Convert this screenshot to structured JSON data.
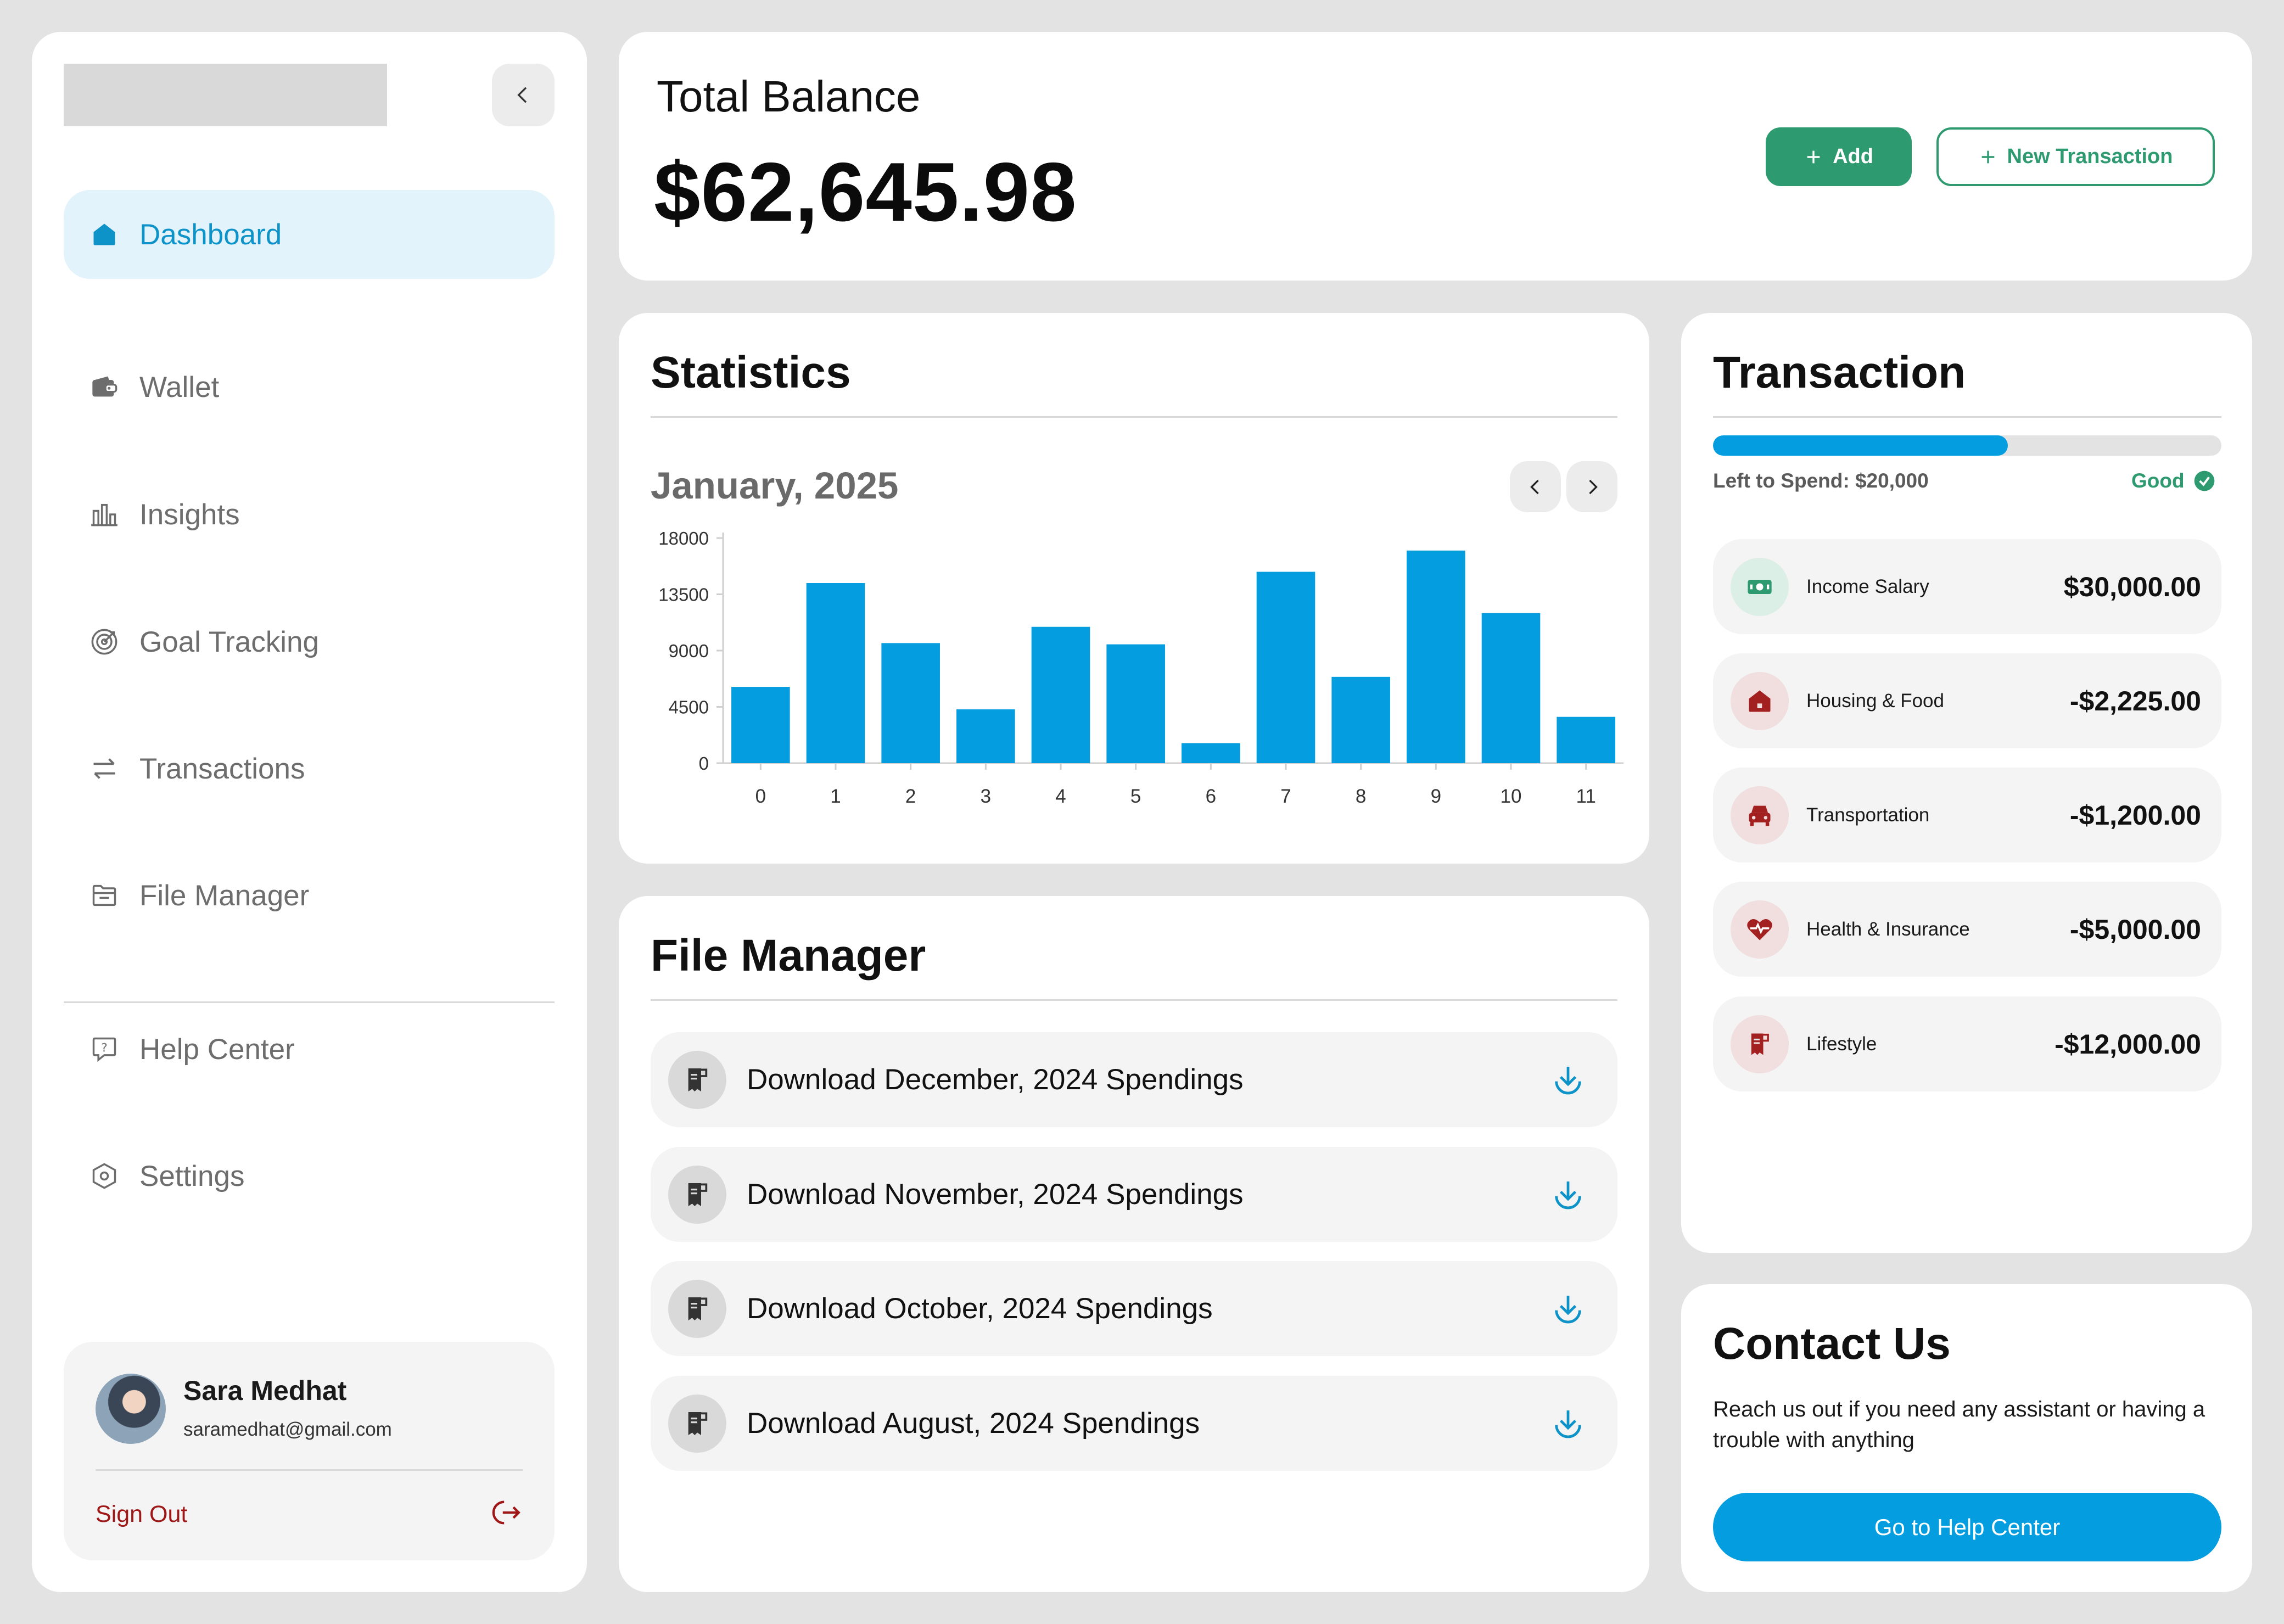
{
  "sidebar": {
    "nav": [
      {
        "label": "Dashboard",
        "icon": "home-icon",
        "active": true
      },
      {
        "label": "Wallet",
        "icon": "wallet-icon"
      },
      {
        "label": "Insights",
        "icon": "bar-chart-icon"
      },
      {
        "label": "Goal Tracking",
        "icon": "target-icon"
      },
      {
        "label": "Transactions",
        "icon": "swap-arrows-icon"
      },
      {
        "label": "File Manager",
        "icon": "folder-icon"
      }
    ],
    "support": [
      {
        "label": "Help Center",
        "icon": "help-chat-icon"
      },
      {
        "label": "Settings",
        "icon": "settings-hex-icon"
      }
    ],
    "profile": {
      "name": "Sara Medhat",
      "email": "saramedhat@gmail.com",
      "sign_out": "Sign Out"
    }
  },
  "balance": {
    "label": "Total Balance",
    "value": "$62,645.98",
    "add_label": "Add",
    "new_transaction_label": "New Transaction"
  },
  "statistics": {
    "title": "Statistics",
    "month": "January, 2025"
  },
  "chart_data": {
    "type": "bar",
    "categories": [
      "0",
      "1",
      "2",
      "3",
      "4",
      "5",
      "6",
      "7",
      "8",
      "9",
      "10",
      "11"
    ],
    "values": [
      6100,
      14400,
      9600,
      4300,
      10900,
      9500,
      1600,
      15300,
      6900,
      17000,
      12000,
      3700
    ],
    "y_ticks": [
      "0",
      "4500",
      "9000",
      "13500",
      "18000"
    ],
    "ylim": [
      0,
      18000
    ],
    "color": "#049ee0",
    "grid": false
  },
  "file_manager": {
    "title": "File Manager",
    "files": [
      {
        "label": "Download December, 2024 Spendings"
      },
      {
        "label": "Download November, 2024 Spendings"
      },
      {
        "label": "Download October, 2024 Spendings"
      },
      {
        "label": "Download August, 2024 Spendings"
      }
    ]
  },
  "transaction": {
    "title": "Transaction",
    "progress": 0.58,
    "left_to_spend": "Left to Spend: $20,000",
    "status": "Good",
    "items": [
      {
        "label": "Income Salary",
        "amount": "$30,000.00",
        "icon": "money-icon",
        "color": "#2e9a6f"
      },
      {
        "label": "Housing & Food",
        "amount": "-$2,225.00",
        "icon": "house-icon",
        "color": "#a32020"
      },
      {
        "label": "Transportation",
        "amount": "-$1,200.00",
        "icon": "car-icon",
        "color": "#a32020"
      },
      {
        "label": "Health & Insurance",
        "amount": "-$5,000.00",
        "icon": "heart-pulse-icon",
        "color": "#a32020"
      },
      {
        "label": "Lifestyle",
        "amount": "-$12,000.00",
        "icon": "receipt-icon",
        "color": "#a32020"
      }
    ]
  },
  "contact": {
    "title": "Contact Us",
    "text": "Reach us out if you need any assistant or having a trouble with anything",
    "button": "Go to Help Center"
  }
}
